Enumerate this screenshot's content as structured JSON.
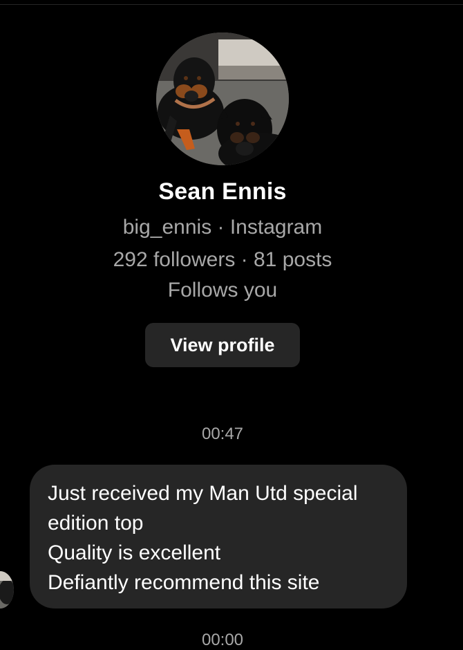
{
  "profile": {
    "name": "Sean Ennis",
    "handle_line": "big_ennis · Instagram",
    "stats_line": "292 followers · 81 posts",
    "follow_status": "Follows you",
    "view_profile_label": "View profile"
  },
  "thread": {
    "timestamp_1": "00:47",
    "timestamp_2": "00:00",
    "message": {
      "line_1": "Just received my Man Utd special",
      "line_2": "edition top",
      "line_3": "Quality is excellent",
      "line_4": "Defiantly recommend this site"
    }
  },
  "colors": {
    "background": "#000000",
    "bubble": "#262626",
    "button": "#262626",
    "secondary_text": "#a8a8a8",
    "primary_text": "#ffffff"
  },
  "icons": {
    "avatar": "profile-photo-two-rottweilers",
    "small_avatar": "sender-avatar"
  }
}
